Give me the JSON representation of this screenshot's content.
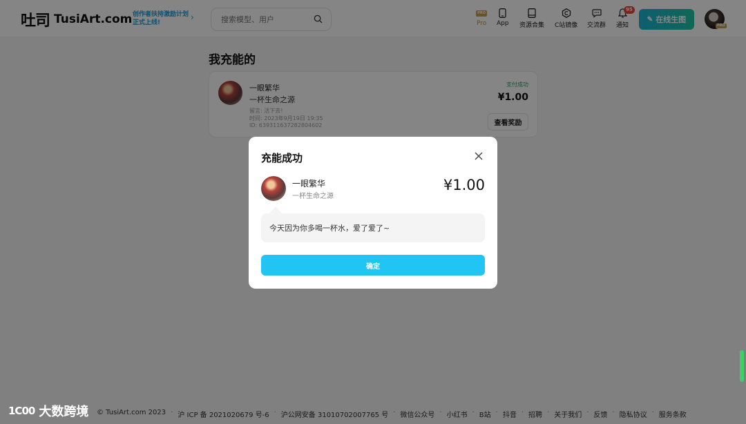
{
  "header": {
    "logo_mark": "吐司",
    "logo_text": "TusiArt.com",
    "promo_line1": "创作者扶持激励计划",
    "promo_line2": "正式上线!",
    "search_placeholder": "搜索模型、用户",
    "nav": [
      {
        "label": "Pro",
        "icon": "pro-badge-icon",
        "badge": "PRO"
      },
      {
        "label": "App",
        "icon": "phone-icon"
      },
      {
        "label": "资源合集",
        "icon": "book-icon"
      },
      {
        "label": "C站镜像",
        "icon": "hexagon-c-icon"
      },
      {
        "label": "交流群",
        "icon": "chat-icon"
      },
      {
        "label": "通知",
        "icon": "bell-icon"
      }
    ],
    "notification_count": "95",
    "generate_button": "在线生图",
    "avatar_badge": "PRO"
  },
  "page": {
    "title": "我充能的",
    "record": {
      "user_name": "一眼繁华",
      "item_name": "一杯生命之源",
      "message": "留言: 活下去!",
      "time": "时间: 2023年9月19日 19:35",
      "id": "ID: 639311637282804602",
      "status": "支付成功",
      "amount": "¥1.00",
      "reward_button": "查看奖励"
    }
  },
  "modal": {
    "title": "充能成功",
    "user_name": "一眼繁华",
    "item_name": "一杯生命之源",
    "amount": "¥1.00",
    "message": "今天因为你多喝一杯水，爱了爱了~",
    "confirm_button": "确定"
  },
  "footer": {
    "items": [
      "© TusiArt.com 2023",
      "沪 ICP 备 2021020679 号-6",
      "沪公网安备 31010702007765 号",
      "微信公众号",
      "小红书",
      "B站",
      "抖音",
      "招聘",
      "关于我们",
      "反馈",
      "隐私协议",
      "服务条款"
    ]
  },
  "watermark": {
    "logo": "1C00",
    "text": "大数跨境"
  },
  "colors": {
    "accent": "#22c4f4",
    "success": "#2a9d67",
    "pro_gold": "#c9a04c",
    "notification": "#e8453c"
  }
}
